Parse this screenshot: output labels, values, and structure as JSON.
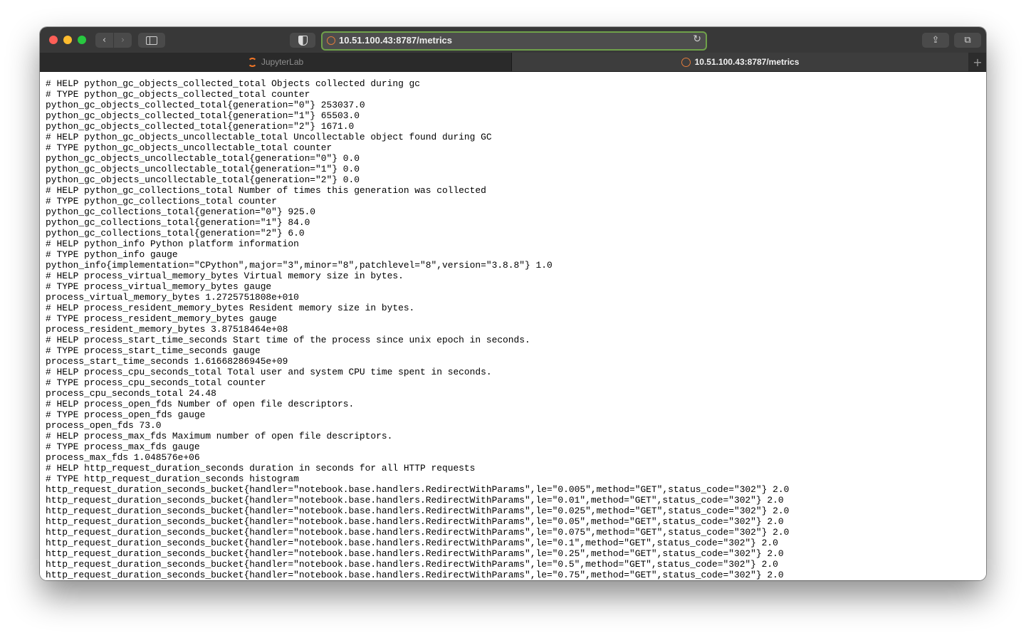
{
  "browser": {
    "address": "10.51.100.43:8787/metrics",
    "icons": {
      "back": "chevron-left-icon",
      "forward": "chevron-right-icon",
      "sidebar": "sidebar-icon",
      "privacy": "shield-icon",
      "reload": "reload-icon",
      "share": "share-icon",
      "tabs": "tab-overview-icon",
      "new_tab": "plus-icon"
    },
    "tabs": [
      {
        "label": "JupyterLab",
        "active": false
      },
      {
        "label": "10.51.100.43:8787/metrics",
        "active": true
      }
    ]
  },
  "colors": {
    "address_border": "#6fa14a",
    "toolbar": "#383838",
    "jupyter_orange": "#f37626"
  },
  "metrics_lines": [
    "# HELP python_gc_objects_collected_total Objects collected during gc",
    "# TYPE python_gc_objects_collected_total counter",
    "python_gc_objects_collected_total{generation=\"0\"} 253037.0",
    "python_gc_objects_collected_total{generation=\"1\"} 65503.0",
    "python_gc_objects_collected_total{generation=\"2\"} 1671.0",
    "# HELP python_gc_objects_uncollectable_total Uncollectable object found during GC",
    "# TYPE python_gc_objects_uncollectable_total counter",
    "python_gc_objects_uncollectable_total{generation=\"0\"} 0.0",
    "python_gc_objects_uncollectable_total{generation=\"1\"} 0.0",
    "python_gc_objects_uncollectable_total{generation=\"2\"} 0.0",
    "# HELP python_gc_collections_total Number of times this generation was collected",
    "# TYPE python_gc_collections_total counter",
    "python_gc_collections_total{generation=\"0\"} 925.0",
    "python_gc_collections_total{generation=\"1\"} 84.0",
    "python_gc_collections_total{generation=\"2\"} 6.0",
    "# HELP python_info Python platform information",
    "# TYPE python_info gauge",
    "python_info{implementation=\"CPython\",major=\"3\",minor=\"8\",patchlevel=\"8\",version=\"3.8.8\"} 1.0",
    "# HELP process_virtual_memory_bytes Virtual memory size in bytes.",
    "# TYPE process_virtual_memory_bytes gauge",
    "process_virtual_memory_bytes 1.2725751808e+010",
    "# HELP process_resident_memory_bytes Resident memory size in bytes.",
    "# TYPE process_resident_memory_bytes gauge",
    "process_resident_memory_bytes 3.87518464e+08",
    "# HELP process_start_time_seconds Start time of the process since unix epoch in seconds.",
    "# TYPE process_start_time_seconds gauge",
    "process_start_time_seconds 1.61668286945e+09",
    "# HELP process_cpu_seconds_total Total user and system CPU time spent in seconds.",
    "# TYPE process_cpu_seconds_total counter",
    "process_cpu_seconds_total 24.48",
    "# HELP process_open_fds Number of open file descriptors.",
    "# TYPE process_open_fds gauge",
    "process_open_fds 73.0",
    "# HELP process_max_fds Maximum number of open file descriptors.",
    "# TYPE process_max_fds gauge",
    "process_max_fds 1.048576e+06",
    "# HELP http_request_duration_seconds duration in seconds for all HTTP requests",
    "# TYPE http_request_duration_seconds histogram",
    "http_request_duration_seconds_bucket{handler=\"notebook.base.handlers.RedirectWithParams\",le=\"0.005\",method=\"GET\",status_code=\"302\"} 2.0",
    "http_request_duration_seconds_bucket{handler=\"notebook.base.handlers.RedirectWithParams\",le=\"0.01\",method=\"GET\",status_code=\"302\"} 2.0",
    "http_request_duration_seconds_bucket{handler=\"notebook.base.handlers.RedirectWithParams\",le=\"0.025\",method=\"GET\",status_code=\"302\"} 2.0",
    "http_request_duration_seconds_bucket{handler=\"notebook.base.handlers.RedirectWithParams\",le=\"0.05\",method=\"GET\",status_code=\"302\"} 2.0",
    "http_request_duration_seconds_bucket{handler=\"notebook.base.handlers.RedirectWithParams\",le=\"0.075\",method=\"GET\",status_code=\"302\"} 2.0",
    "http_request_duration_seconds_bucket{handler=\"notebook.base.handlers.RedirectWithParams\",le=\"0.1\",method=\"GET\",status_code=\"302\"} 2.0",
    "http_request_duration_seconds_bucket{handler=\"notebook.base.handlers.RedirectWithParams\",le=\"0.25\",method=\"GET\",status_code=\"302\"} 2.0",
    "http_request_duration_seconds_bucket{handler=\"notebook.base.handlers.RedirectWithParams\",le=\"0.5\",method=\"GET\",status_code=\"302\"} 2.0",
    "http_request_duration_seconds_bucket{handler=\"notebook.base.handlers.RedirectWithParams\",le=\"0.75\",method=\"GET\",status_code=\"302\"} 2.0"
  ]
}
